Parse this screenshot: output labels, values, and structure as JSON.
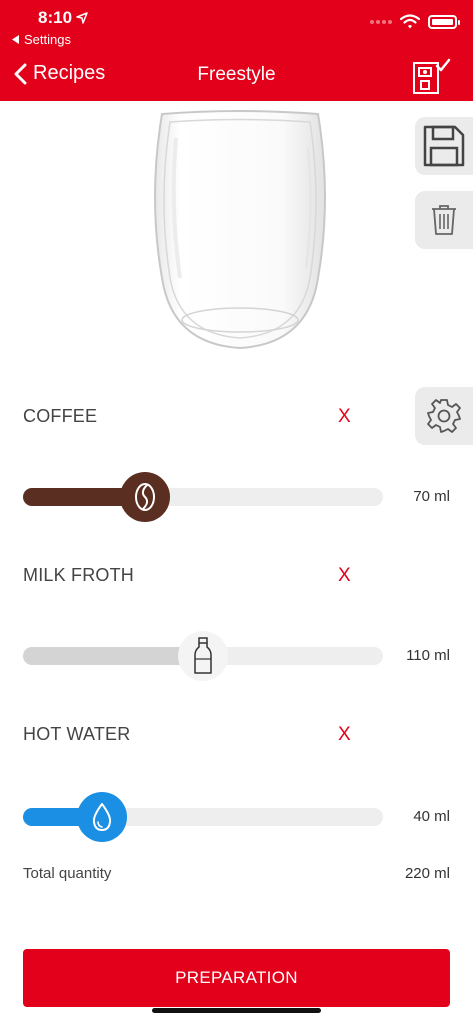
{
  "status": {
    "time": "8:10",
    "back_label": "Settings"
  },
  "nav": {
    "back_label": "Recipes",
    "title": "Freestyle"
  },
  "ingredients": [
    {
      "label": "COFFEE",
      "remove": "X",
      "value": "70 ml",
      "level": 0.34,
      "color": "#5a2e21",
      "icon": "coffee-bean-icon"
    },
    {
      "label": "MILK FROTH",
      "remove": "X",
      "value": "110 ml",
      "level": 0.5,
      "color": "#d4d4d4",
      "icon": "milk-bottle-icon"
    },
    {
      "label": "HOT WATER",
      "remove": "X",
      "value": "40 ml",
      "level": 0.22,
      "color": "#1a8fe3",
      "icon": "water-drop-icon"
    }
  ],
  "total": {
    "label": "Total quantity",
    "value": "220 ml"
  },
  "preparation_label": "PREPARATION",
  "colors": {
    "accent": "#e2001a",
    "side_button_bg": "#ebebeb",
    "track": "#eeeeee"
  },
  "icons": [
    "location-arrow-icon",
    "back-arrow-icon",
    "wifi-icon",
    "battery-icon",
    "machine-check-icon",
    "save-icon",
    "trash-icon",
    "gear-icon"
  ]
}
